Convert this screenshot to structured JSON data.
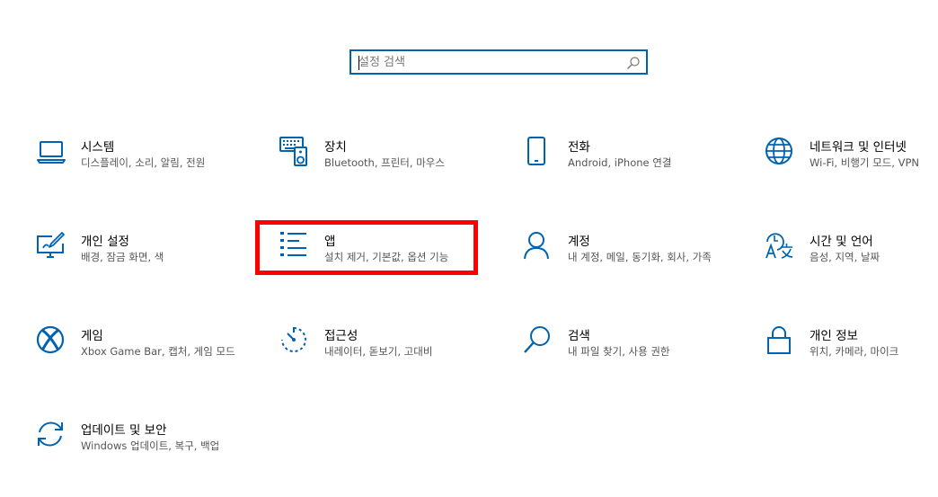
{
  "search": {
    "placeholder": "설정 검색"
  },
  "accent_color": "#0063b1",
  "highlight_color": "#ff0000",
  "tiles": [
    {
      "icon": "laptop-icon",
      "title": "시스템",
      "desc": "디스플레이, 소리, 알림, 전원"
    },
    {
      "icon": "keyboard-speaker-icon",
      "title": "장치",
      "desc": "Bluetooth, 프린터, 마우스"
    },
    {
      "icon": "phone-icon",
      "title": "전화",
      "desc": "Android, iPhone 연결"
    },
    {
      "icon": "globe-icon",
      "title": "네트워크 및 인터넷",
      "desc": "Wi-Fi, 비행기 모드, VPN"
    },
    {
      "icon": "personalization-icon",
      "title": "개인 설정",
      "desc": "배경, 잠금 화면, 색"
    },
    {
      "icon": "apps-list-icon",
      "title": "앱",
      "desc": "설치 제거, 기본값, 옵션 기능"
    },
    {
      "icon": "person-icon",
      "title": "계정",
      "desc": "내 계정, 메일, 동기화, 회사, 가족"
    },
    {
      "icon": "language-icon",
      "title": "시간 및 언어",
      "desc": "음성, 지역, 날짜"
    },
    {
      "icon": "xbox-icon",
      "title": "게임",
      "desc": "Xbox Game Bar, 캡처, 게임 모드"
    },
    {
      "icon": "accessibility-timer-icon",
      "title": "접근성",
      "desc": "내레이터, 돋보기, 고대비"
    },
    {
      "icon": "search-icon",
      "title": "검색",
      "desc": "내 파일 찾기, 사용 권한"
    },
    {
      "icon": "lock-icon",
      "title": "개인 정보",
      "desc": "위치, 카메라, 마이크"
    },
    {
      "icon": "sync-icon",
      "title": "업데이트 및 보안",
      "desc": "Windows 업데이트, 복구, 백업"
    }
  ]
}
